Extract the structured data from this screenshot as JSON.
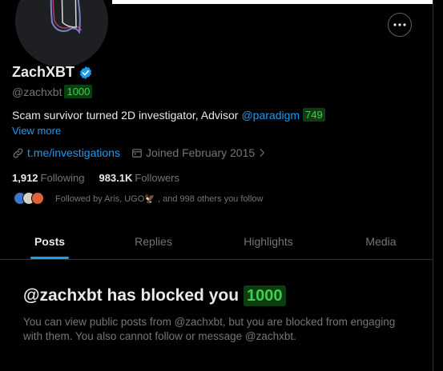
{
  "profile": {
    "display_name": "ZachXBT",
    "handle": "@zachxbt",
    "handle_badge": "1000",
    "bio_text": "Scam survivor turned 2D investigator, Advisor",
    "bio_mention": "@paradigm",
    "bio_badge": "749",
    "view_more": "View more",
    "link": "t.me/investigations",
    "joined": "Joined February 2015",
    "following_count": "1,912",
    "following_label": "Following",
    "followers_count": "983.1K",
    "followers_label": "Followers",
    "followed_by": "Followed by Aris, UGO🦅 , and 998 others you follow"
  },
  "tabs": [
    {
      "label": "Posts",
      "active": true
    },
    {
      "label": "Replies",
      "active": false
    },
    {
      "label": "Highlights",
      "active": false
    },
    {
      "label": "Media",
      "active": false
    }
  ],
  "blocked": {
    "title": "@zachxbt has blocked you",
    "badge": "1000",
    "description": "You can view public posts from @zachxbt, but you are blocked from engaging with them. You also cannot follow or message @zachxbt."
  },
  "colors": {
    "background": "#000000",
    "accent": "#1d9bf0",
    "badge_bg": "#0f3d12",
    "badge_text": "#3cd04a"
  },
  "icons": [
    "more-icon",
    "verified-icon",
    "link-icon",
    "calendar-icon",
    "chevron-right-icon"
  ]
}
